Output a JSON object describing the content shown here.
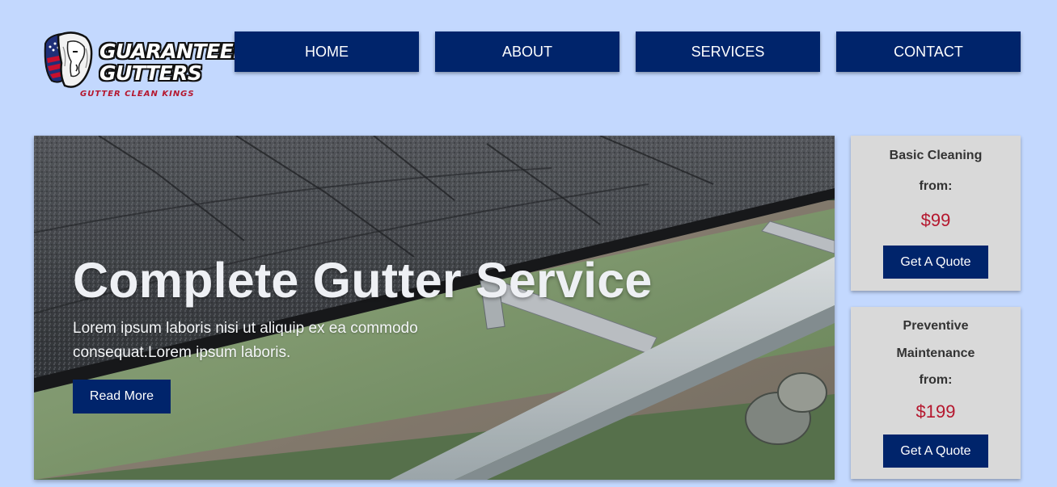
{
  "logo": {
    "line1": "GUARANTEED",
    "line2": "GUTTERS",
    "tagline": "GUTTER CLEAN KINGS"
  },
  "nav": [
    {
      "label": "HOME"
    },
    {
      "label": "ABOUT"
    },
    {
      "label": "SERVICES"
    },
    {
      "label": "CONTACT"
    }
  ],
  "hero": {
    "title": "Complete Gutter Service",
    "text": "Lorem ipsum laboris nisi ut aliquip ex ea commodo consequat.Lorem ipsum laboris.",
    "button": "Read More"
  },
  "pricing": [
    {
      "title_lines": [
        "Basic Cleaning",
        "from:"
      ],
      "price": "$99",
      "button": "Get A Quote"
    },
    {
      "title_lines": [
        "Preventive",
        "Maintenance",
        "from:"
      ],
      "price": "$199",
      "button": "Get A Quote"
    }
  ],
  "colors": {
    "page_bg": "#c3d8fe",
    "nav_bg": "#00246b",
    "price": "#b5172e",
    "card_bg": "#d9d9d9"
  }
}
